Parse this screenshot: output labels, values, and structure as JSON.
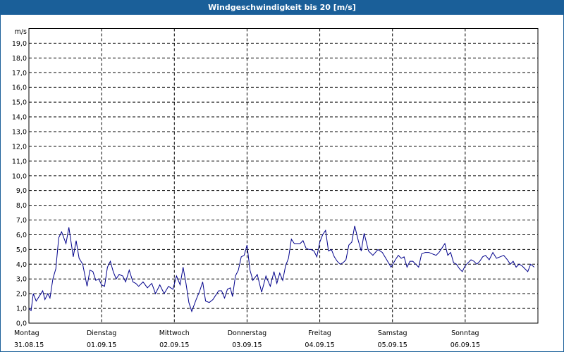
{
  "window": {
    "title": "Windgeschwindigkeit bis 20 [m/s]"
  },
  "colors": {
    "titlebar": "#1a5f99",
    "series": "#00008b",
    "grid": "#000000"
  },
  "chart_data": {
    "type": "line",
    "title": "Windgeschwindigkeit bis 20 [m/s]",
    "ylabel": "m/s",
    "ylim": [
      0,
      20
    ],
    "y_ticks": [
      "0,0",
      "1,0",
      "2,0",
      "3,0",
      "4,0",
      "5,0",
      "6,0",
      "7,0",
      "8,0",
      "9,0",
      "10,0",
      "11,0",
      "12,0",
      "13,0",
      "14,0",
      "15,0",
      "16,0",
      "17,0",
      "18,0",
      "19,0"
    ],
    "grid": "dashed",
    "x_unit": "days since 31.08.15 00:00",
    "x_range": [
      0,
      7
    ],
    "days": [
      {
        "weekday": "Montag",
        "date": "31.08.15"
      },
      {
        "weekday": "Dienstag",
        "date": "01.09.15"
      },
      {
        "weekday": "Mittwoch",
        "date": "02.09.15"
      },
      {
        "weekday": "Donnerstag",
        "date": "03.09.15"
      },
      {
        "weekday": "Freitag",
        "date": "04.09.15"
      },
      {
        "weekday": "Samstag",
        "date": "05.09.15"
      },
      {
        "weekday": "Sonntag",
        "date": "06.09.15"
      }
    ],
    "series": [
      {
        "x": [
          0.0,
          0.03,
          0.06,
          0.1,
          0.14,
          0.19,
          0.22,
          0.26,
          0.29,
          0.33,
          0.37,
          0.41,
          0.45,
          0.51,
          0.55,
          0.61,
          0.65,
          0.69,
          0.74,
          0.8,
          0.84,
          0.88,
          0.92,
          0.96,
          1.0,
          1.04,
          1.08,
          1.12,
          1.16,
          1.2,
          1.24,
          1.29,
          1.33,
          1.38,
          1.43,
          1.47,
          1.51,
          1.57,
          1.63,
          1.69,
          1.74,
          1.8,
          1.86,
          1.92,
          1.98,
          2.03,
          2.08,
          2.12,
          2.16,
          2.2,
          2.24,
          2.3,
          2.35,
          2.39,
          2.43,
          2.48,
          2.53,
          2.57,
          2.61,
          2.65,
          2.69,
          2.73,
          2.77,
          2.8,
          2.84,
          2.88,
          2.92,
          2.96,
          3.0,
          3.04,
          3.08,
          3.14,
          3.2,
          3.26,
          3.32,
          3.37,
          3.41,
          3.45,
          3.49,
          3.53,
          3.57,
          3.61,
          3.65,
          3.69,
          3.73,
          3.77,
          3.81,
          3.85,
          3.88,
          3.92,
          3.96,
          4.0,
          4.04,
          4.08,
          4.12,
          4.16,
          4.2,
          4.24,
          4.28,
          4.32,
          4.36,
          4.4,
          4.44,
          4.48,
          4.53,
          4.57,
          4.61,
          4.67,
          4.73,
          4.8,
          4.86,
          4.92,
          4.98,
          5.04,
          5.08,
          5.12,
          5.16,
          5.2,
          5.24,
          5.28,
          5.32,
          5.36,
          5.4,
          5.45,
          5.5,
          5.55,
          5.6,
          5.64,
          5.68,
          5.72,
          5.76,
          5.8,
          5.84,
          5.88,
          5.92,
          5.96,
          6.0,
          6.04,
          6.08,
          6.12,
          6.16,
          6.2,
          6.24,
          6.28,
          6.33,
          6.38,
          6.43,
          6.48,
          6.53,
          6.58,
          6.62,
          6.66,
          6.7,
          6.74,
          6.78,
          6.82,
          6.86,
          6.9,
          6.95
        ],
        "y": [
          1.0,
          0.85,
          2.0,
          1.5,
          1.8,
          2.2,
          1.6,
          2.0,
          1.7,
          3.0,
          3.7,
          5.8,
          6.2,
          5.4,
          6.5,
          4.5,
          5.6,
          4.4,
          4.0,
          2.5,
          3.6,
          3.5,
          2.9,
          3.0,
          2.6,
          2.5,
          3.8,
          4.2,
          3.5,
          3.0,
          3.3,
          3.2,
          2.8,
          3.6,
          2.8,
          2.7,
          2.5,
          2.8,
          2.4,
          2.7,
          2.0,
          2.6,
          2.0,
          2.5,
          2.3,
          3.2,
          2.6,
          3.8,
          2.7,
          1.4,
          0.8,
          1.6,
          2.2,
          2.8,
          1.5,
          1.4,
          1.6,
          1.9,
          2.2,
          2.2,
          1.7,
          2.3,
          2.4,
          1.8,
          3.2,
          3.6,
          4.5,
          4.6,
          5.3,
          3.6,
          2.9,
          3.3,
          2.1,
          3.2,
          2.5,
          3.5,
          2.7,
          3.4,
          2.9,
          3.9,
          4.4,
          5.7,
          5.4,
          5.4,
          5.4,
          5.6,
          5.1,
          5.0,
          5.0,
          4.9,
          4.5,
          5.5,
          6.0,
          6.3,
          4.9,
          5.0,
          4.5,
          4.2,
          4.0,
          4.1,
          4.3,
          5.3,
          5.5,
          6.6,
          5.6,
          4.9,
          6.1,
          4.9,
          4.6,
          5.0,
          4.8,
          4.3,
          3.8,
          4.3,
          4.6,
          4.4,
          4.5,
          3.8,
          4.2,
          4.2,
          4.0,
          3.8,
          4.7,
          4.8,
          4.8,
          4.7,
          4.6,
          4.8,
          5.1,
          5.4,
          4.6,
          4.8,
          4.1,
          4.0,
          3.7,
          3.5,
          3.9,
          4.1,
          4.3,
          4.2,
          4.0,
          4.2,
          4.5,
          4.6,
          4.3,
          4.8,
          4.4,
          4.5,
          4.6,
          4.3,
          4.0,
          4.2,
          3.8,
          4.0,
          3.9,
          3.7,
          3.5,
          4.0,
          3.8
        ]
      }
    ]
  }
}
